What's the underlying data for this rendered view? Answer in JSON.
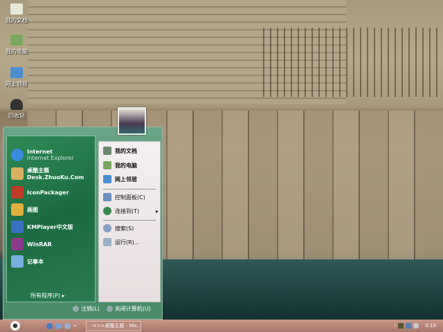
{
  "desktop": {
    "icons": [
      {
        "label": "我的文档"
      },
      {
        "label": "我的电脑"
      },
      {
        "label": "网上邻居"
      },
      {
        "label": "回收站"
      }
    ]
  },
  "start_menu": {
    "pinned": [
      {
        "title": "Internet",
        "subtitle": "Internet Explorer",
        "icon": "ie-icon",
        "color": "#3a8ae0"
      },
      {
        "title": "桌酷主题",
        "subtitle": "Desk.ZhuoKu.Com",
        "icon": "zhuoku-icon",
        "color": "#d8b060"
      },
      {
        "title": "IconPackager",
        "icon": "iconpackager-icon",
        "color": "#c03a2a"
      },
      {
        "title": "画图",
        "icon": "paint-icon",
        "color": "#e0b040"
      },
      {
        "title": "KMPlayer中文版",
        "icon": "kmplayer-icon",
        "color": "#3a70c0"
      },
      {
        "title": "WinRAR",
        "icon": "winrar-icon",
        "color": "#8a3a8a"
      },
      {
        "title": "记事本",
        "icon": "notepad-icon",
        "color": "#7ab0e0"
      }
    ],
    "all_programs": "所有程序(P)",
    "right": [
      {
        "label": "我的文档",
        "bold": true,
        "icon": "my-documents-icon"
      },
      {
        "label": "我的电脑",
        "bold": true,
        "icon": "my-computer-icon"
      },
      {
        "label": "网上邻居",
        "bold": true,
        "icon": "network-icon"
      },
      {
        "label": "控制面板(C)",
        "icon": "control-panel-icon"
      },
      {
        "label": "连接到(T)",
        "icon": "connect-icon",
        "arrow": "▸"
      },
      {
        "label": "搜索(S)",
        "icon": "search-icon"
      },
      {
        "label": "运行(R)...",
        "icon": "run-icon"
      }
    ],
    "logoff": "注销(L)",
    "shutdown": "关闭计算机(U)"
  },
  "taskbar": {
    "task": "-=>>桌酷主题 - Mic...",
    "clock": "0:10",
    "tray_chevron": "‹",
    "ql_chevron": "»"
  }
}
